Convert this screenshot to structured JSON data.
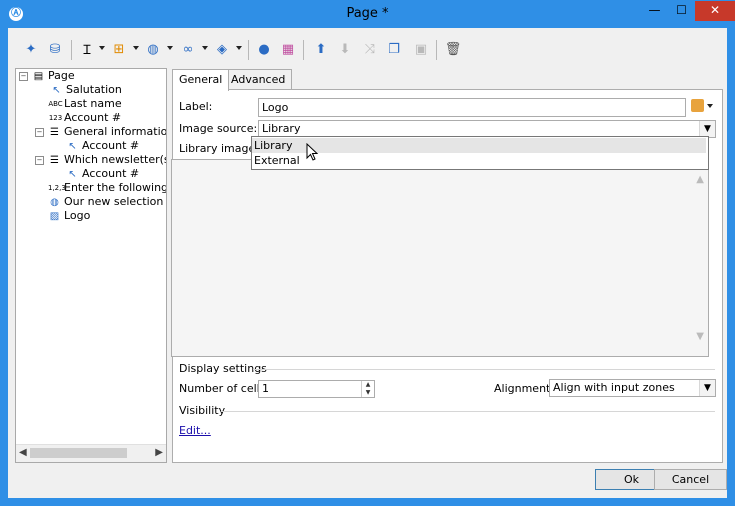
{
  "window": {
    "title": "Page *",
    "app_icon": "adobe-campaign-icon",
    "minimize_glyph": "—",
    "maximize_glyph": "☐",
    "close_glyph": "✕"
  },
  "toolbar": {
    "icons": [
      "magic-wand-icon",
      "database-add-icon",
      "text-cursor-icon",
      "add-container-icon",
      "globe-icon",
      "link-icon",
      "layers-icon",
      "person-icon",
      "grid-icon",
      "move-up-icon",
      "move-down-icon",
      "shuffle-icon",
      "copy-icon",
      "paste-icon",
      "delete-icon"
    ]
  },
  "tree": {
    "nodes": [
      {
        "label": "Page",
        "icon": "page-icon",
        "expand": "⊟"
      },
      {
        "label": "Salutation",
        "icon": "cursor-field-icon"
      },
      {
        "label": "Last name",
        "icon": "abc-text-icon",
        "prefix": "ABC"
      },
      {
        "label": "Account #",
        "icon": "number-icon",
        "prefix": "123"
      },
      {
        "label": "General information",
        "icon": "table-icon",
        "expand": "⊟"
      },
      {
        "label": "Account #",
        "icon": "cursor-field-icon"
      },
      {
        "label": "Which newsletter(s) co",
        "icon": "table-icon",
        "expand": "⊟"
      },
      {
        "label": "Account #",
        "icon": "cursor-field-icon"
      },
      {
        "label": "Enter the following ch",
        "icon": "numeric-icon",
        "prefix": "1,2,3"
      },
      {
        "label": "Our new selection",
        "icon": "globe-icon"
      },
      {
        "label": "Logo",
        "icon": "image-icon"
      }
    ]
  },
  "tabs": [
    {
      "label": "General"
    },
    {
      "label": "Advanced"
    }
  ],
  "form": {
    "label_caption": "Label:",
    "label_value": "Logo",
    "image_source_caption": "Image source:",
    "image_source_value": "Library",
    "library_image_caption": "Library image:",
    "dropdown_options": [
      "Library",
      "External"
    ],
    "display_settings_caption": "Display settings",
    "number_of_cells_caption": "Number of cells:",
    "number_of_cells_value": "1",
    "alignment_caption": "Alignment:",
    "alignment_value": "Align with input zones",
    "visibility_caption": "Visibility",
    "edit_link": "Edit..."
  },
  "buttons": {
    "ok": "Ok",
    "cancel": "Cancel"
  },
  "colors": {
    "title_bar": "#2f8fe6",
    "close_button": "#c7392a",
    "link": "#1a0dab"
  }
}
